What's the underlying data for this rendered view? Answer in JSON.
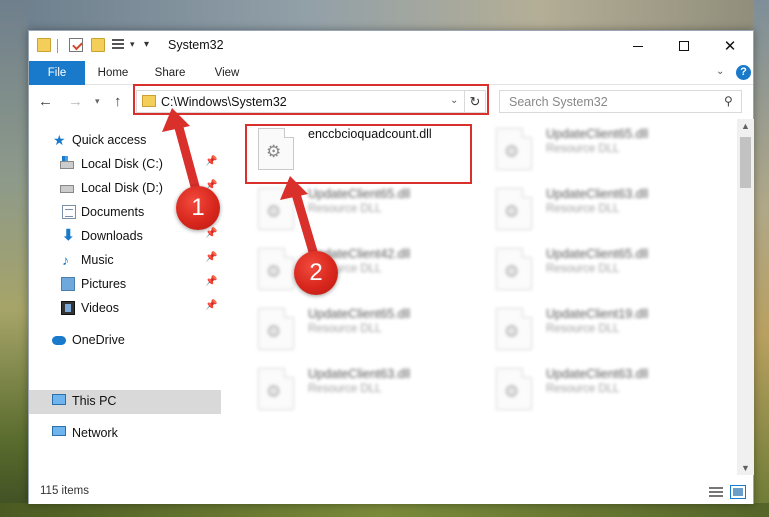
{
  "window": {
    "title": "System32",
    "controls": {
      "minimize": "minimize",
      "maximize": "maximize",
      "close": "✕"
    }
  },
  "ribbon": {
    "tabs": [
      "File",
      "Home",
      "Share",
      "View"
    ],
    "help": "?"
  },
  "nav": {
    "address": "C:\\Windows\\System32",
    "search_placeholder": "Search System32"
  },
  "sidebar": {
    "items": [
      {
        "label": "Quick access",
        "icon": "star-icon",
        "pinned": false
      },
      {
        "label": "Local Disk (C:)",
        "icon": "drive-c-icon",
        "pinned": true
      },
      {
        "label": "Local Disk (D:)",
        "icon": "drive-d-icon",
        "pinned": true
      },
      {
        "label": "Documents",
        "icon": "documents-icon",
        "pinned": true
      },
      {
        "label": "Downloads",
        "icon": "downloads-icon",
        "pinned": true
      },
      {
        "label": "Music",
        "icon": "music-icon",
        "pinned": true
      },
      {
        "label": "Pictures",
        "icon": "pictures-icon",
        "pinned": true
      },
      {
        "label": "Videos",
        "icon": "videos-icon",
        "pinned": true
      },
      {
        "label": "OneDrive",
        "icon": "onedrive-icon",
        "pinned": false
      },
      {
        "label": "This PC",
        "icon": "this-pc-icon",
        "pinned": false
      },
      {
        "label": "Network",
        "icon": "network-icon",
        "pinned": false
      }
    ]
  },
  "files": [
    {
      "name": "enccbcioquadcount.dll",
      "type": "",
      "blurred": false
    },
    {
      "name": "UpdateClient65.dll",
      "type": "Resource DLL",
      "blurred": true
    },
    {
      "name": "UpdateClient65.dll",
      "type": "Resource DLL",
      "blurred": true
    },
    {
      "name": "UpdateClient63.dll",
      "type": "Resource DLL",
      "blurred": true
    },
    {
      "name": "UpdateClient42.dll",
      "type": "Resource DLL",
      "blurred": true
    },
    {
      "name": "UpdateClient65.dll",
      "type": "Resource DLL",
      "blurred": true
    },
    {
      "name": "UpdateClient65.dll",
      "type": "Resource DLL",
      "blurred": true
    },
    {
      "name": "UpdateClient19.dll",
      "type": "Resource DLL",
      "blurred": true
    },
    {
      "name": "UpdateClient63.dll",
      "type": "Resource DLL",
      "blurred": true
    },
    {
      "name": "UpdateClient63.dll",
      "type": "Resource DLL",
      "blurred": true
    }
  ],
  "status": {
    "item_count": "115 items"
  },
  "annotations": {
    "step1": "1",
    "step2": "2",
    "color": "#d9302c"
  },
  "colors": {
    "accent": "#1979ca",
    "selection": "#cce8ff"
  }
}
